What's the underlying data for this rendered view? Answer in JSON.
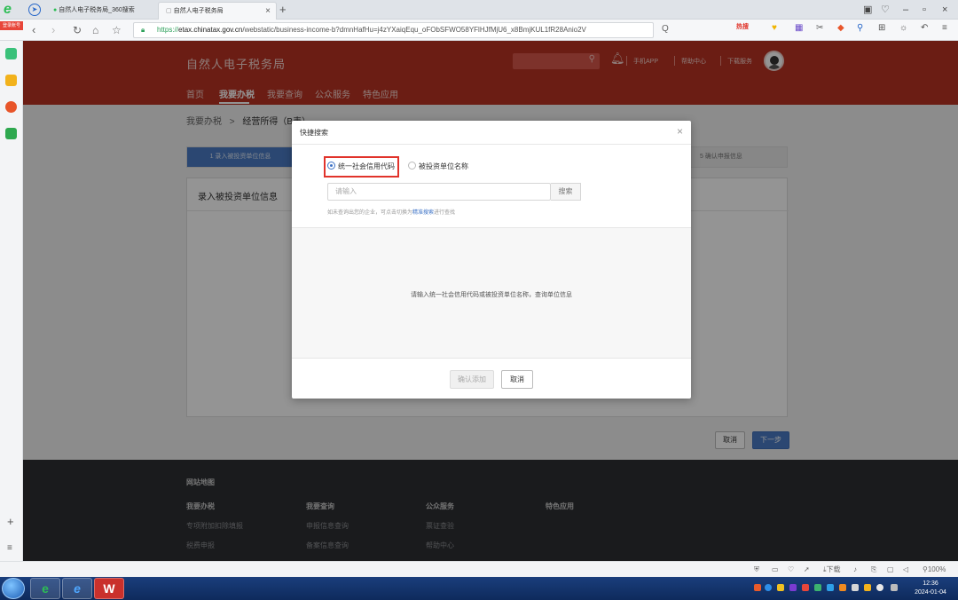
{
  "browser": {
    "tabs": [
      {
        "title": "自然人电子税务局_360搜索",
        "active": false
      },
      {
        "title": "自然人电子税务局",
        "active": true
      }
    ],
    "new_tab": "+",
    "url_https": "https://",
    "url_host": "etax.chinatax.gov.cn",
    "url_path": "/webstatic/business-income-b?dmnHafHu=j4zYXaiqEqu_oFObSFWO58YFlHJfMjU6_x8BmjKUL1fR28Anio2V",
    "search_placeholder": "Q",
    "hot_label": "热搜",
    "zoom": "100%",
    "status_download": "下载",
    "sidebar_badge": "登录账号"
  },
  "site": {
    "title": "自然人电子税务局",
    "header_links": [
      "手机APP",
      "帮助中心",
      "下载服务"
    ],
    "nav": [
      "首页",
      "我要办税",
      "我要查询",
      "公众服务",
      "特色应用"
    ],
    "nav_active": "我要办税",
    "breadcrumb": {
      "root": "我要办税",
      "sep": ">",
      "current": "经营所得（B表）"
    },
    "steps": {
      "step1": "1  录入被投资单位信息",
      "step5": "5  确认申报信息"
    },
    "card_title": "录入被投资单位信息",
    "buttons": {
      "cancel": "取消",
      "next": "下一步"
    }
  },
  "footer": {
    "title": "网站地图",
    "columns": [
      {
        "heading": "我要办税",
        "links": [
          "专项附加扣除填报",
          "税费申报"
        ]
      },
      {
        "heading": "我要查询",
        "links": [
          "申报信息查询",
          "备案信息查询"
        ]
      },
      {
        "heading": "公众服务",
        "links": [
          "票证查验",
          "帮助中心"
        ]
      },
      {
        "heading": "特色应用",
        "links": []
      }
    ]
  },
  "modal": {
    "title": "快捷搜索",
    "close": "×",
    "radio_options": [
      "统一社会信用代码",
      "被投资单位名称"
    ],
    "radio_selected": 0,
    "input_placeholder": "请输入",
    "search_button": "搜索",
    "hint_prefix": "如未查询出您的企业，可点击切换为",
    "hint_link": "精准搜索",
    "hint_suffix": "进行查找",
    "empty_text": "请输入统一社会信用代码或被投资单位名称，查询单位信息",
    "confirm_button": "确认添加",
    "cancel_button": "取消"
  },
  "taskbar": {
    "time": "12:36",
    "date": "2024-01-04"
  }
}
